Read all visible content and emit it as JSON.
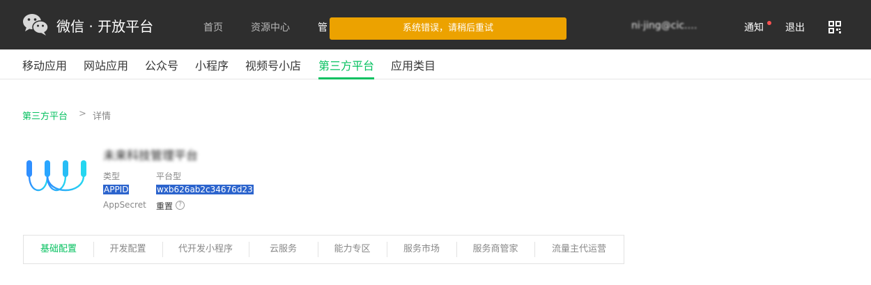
{
  "header": {
    "brand": "微信 · 开放平台",
    "nav": [
      "首页",
      "资源中心",
      "管"
    ],
    "toast": "系统错误，请稍后重试",
    "user": "ni·jing@cic.…",
    "notify_label": "通知",
    "logout_label": "退出"
  },
  "categories": [
    "移动应用",
    "网站应用",
    "公众号",
    "小程序",
    "视频号小店",
    "第三方平台",
    "应用类目"
  ],
  "breadcrumb": {
    "parent": "第三方平台",
    "separator": ">",
    "current": "详情"
  },
  "app": {
    "name": "未来科技管理平台",
    "type_label": "类型",
    "type_value": "平台型",
    "appid_label": "APPID",
    "appid_value": "wxb626ab2c34676d23",
    "secret_label": "AppSecret",
    "reset_label": "重置",
    "help_glyph": "?"
  },
  "tabs": [
    "基础配置",
    "开发配置",
    "代开发小程序",
    "云服务",
    "能力专区",
    "服务市场",
    "服务商管家",
    "流量主代运营"
  ],
  "colors": {
    "accent": "#07c160",
    "toast": "#eca200",
    "topbar": "#2e2e2e",
    "selection": "#2c64cd"
  }
}
